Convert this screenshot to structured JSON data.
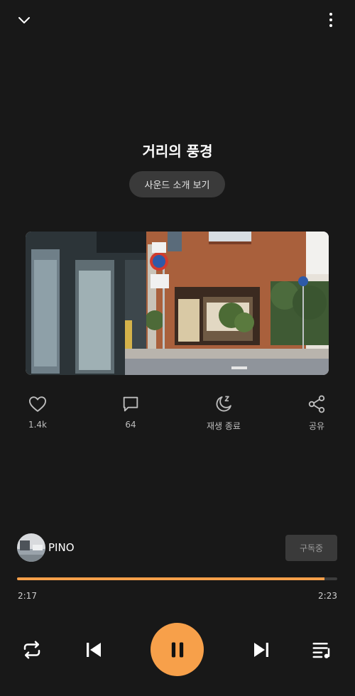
{
  "track": {
    "title": "거리의 풍경",
    "intro_label": "사운드 소개 보기"
  },
  "actions": {
    "like_count": "1.4k",
    "comment_count": "64",
    "sleep_timer_label": "재생 종료",
    "share_label": "공유"
  },
  "artist": {
    "name": "PINO",
    "subscribe_label": "구독중"
  },
  "playback": {
    "elapsed": "2:17",
    "duration": "2:23",
    "progress": 0.96,
    "state": "playing"
  },
  "colors": {
    "accent": "#f7a04a",
    "background": "#181818"
  },
  "icons": {
    "top_left": "chevron-down-icon",
    "top_right": "more-vertical-icon",
    "like": "heart-icon",
    "comment": "comment-icon",
    "sleep": "moon-zzz-icon",
    "share": "share-icon",
    "repeat": "repeat-icon",
    "previous": "skip-previous-icon",
    "play_pause": "pause-icon",
    "next": "skip-next-icon",
    "queue": "playlist-icon"
  }
}
